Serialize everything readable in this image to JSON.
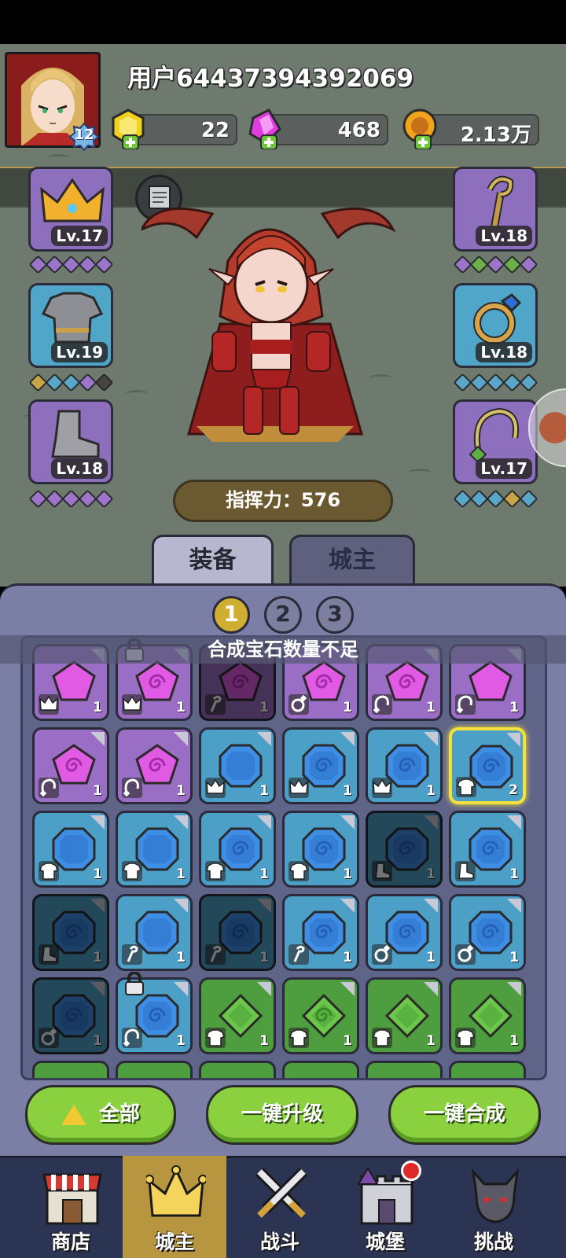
{
  "header": {
    "username": "用户64437394392069",
    "avatar_level": "12",
    "resources": [
      {
        "name": "gold-gem",
        "value": "22"
      },
      {
        "name": "pink-crystal",
        "value": "468"
      },
      {
        "name": "coin",
        "value": "2.13万"
      }
    ]
  },
  "equipment": {
    "left_slots": [
      {
        "item": "crown",
        "level": "Lv.17"
      },
      {
        "item": "armor",
        "level": "Lv.19"
      },
      {
        "item": "boots",
        "level": "Lv.18"
      }
    ],
    "right_slots": [
      {
        "item": "staff",
        "level": "Lv.18"
      },
      {
        "item": "ring",
        "level": "Lv.18"
      },
      {
        "item": "necklace",
        "level": "Lv.17"
      }
    ],
    "power_label": "指挥力：576"
  },
  "tabs": [
    {
      "label": "装备",
      "active": true
    },
    {
      "label": "城主",
      "active": false
    }
  ],
  "pages": [
    "1",
    "2",
    "3"
  ],
  "active_page": "1",
  "toast": "合成宝石数量不足",
  "inventory": [
    {
      "color": "purple",
      "type": "crown-icon",
      "count": "1",
      "dim": false,
      "locked": false,
      "spiral": false
    },
    {
      "color": "purple",
      "type": "crown-icon",
      "count": "1",
      "dim": false,
      "locked": true,
      "spiral": true
    },
    {
      "color": "purple",
      "type": "staff-icon",
      "count": "1",
      "dim": true,
      "locked": false,
      "spiral": true
    },
    {
      "color": "purple",
      "type": "ring-icon",
      "count": "1",
      "dim": false,
      "locked": false,
      "spiral": true
    },
    {
      "color": "purple",
      "type": "necklace-icon",
      "count": "1",
      "dim": false,
      "locked": false,
      "spiral": true
    },
    {
      "color": "purple",
      "type": "necklace-icon",
      "count": "1",
      "dim": false,
      "locked": false,
      "spiral": false
    },
    {
      "color": "purple",
      "type": "necklace-icon",
      "count": "1",
      "dim": false,
      "locked": false,
      "spiral": true
    },
    {
      "color": "purple",
      "type": "necklace-icon",
      "count": "1",
      "dim": false,
      "locked": false,
      "spiral": true
    },
    {
      "color": "blue",
      "type": "crown-icon",
      "count": "1",
      "dim": false,
      "locked": false,
      "spiral": false
    },
    {
      "color": "blue",
      "type": "crown-icon",
      "count": "1",
      "dim": false,
      "locked": false,
      "spiral": true
    },
    {
      "color": "blue",
      "type": "crown-icon",
      "count": "1",
      "dim": false,
      "locked": false,
      "spiral": true
    },
    {
      "color": "blue",
      "type": "armor-icon",
      "count": "2",
      "dim": false,
      "locked": false,
      "spiral": true,
      "selected": true
    },
    {
      "color": "blue",
      "type": "armor-icon",
      "count": "1",
      "dim": false,
      "locked": false,
      "spiral": false
    },
    {
      "color": "blue",
      "type": "armor-icon",
      "count": "1",
      "dim": false,
      "locked": false,
      "spiral": false
    },
    {
      "color": "blue",
      "type": "armor-icon",
      "count": "1",
      "dim": false,
      "locked": false,
      "spiral": true
    },
    {
      "color": "blue",
      "type": "armor-icon",
      "count": "1",
      "dim": false,
      "locked": false,
      "spiral": true
    },
    {
      "color": "blue",
      "type": "boots-icon",
      "count": "1",
      "dim": true,
      "locked": false,
      "spiral": true
    },
    {
      "color": "blue",
      "type": "boots-icon",
      "count": "1",
      "dim": false,
      "locked": false,
      "spiral": true
    },
    {
      "color": "blue",
      "type": "boots-icon",
      "count": "1",
      "dim": true,
      "locked": false,
      "spiral": true
    },
    {
      "color": "blue",
      "type": "staff-icon",
      "count": "1",
      "dim": false,
      "locked": false,
      "spiral": false
    },
    {
      "color": "blue",
      "type": "staff-icon",
      "count": "1",
      "dim": true,
      "locked": false,
      "spiral": true
    },
    {
      "color": "blue",
      "type": "staff-icon",
      "count": "1",
      "dim": false,
      "locked": false,
      "spiral": true
    },
    {
      "color": "blue",
      "type": "ring-icon",
      "count": "1",
      "dim": false,
      "locked": false,
      "spiral": true
    },
    {
      "color": "blue",
      "type": "ring-icon",
      "count": "1",
      "dim": false,
      "locked": false,
      "spiral": true
    },
    {
      "color": "blue",
      "type": "ring-icon",
      "count": "1",
      "dim": true,
      "locked": false,
      "spiral": true
    },
    {
      "color": "blue",
      "type": "necklace-icon",
      "count": "1",
      "dim": false,
      "locked": true,
      "spiral": true
    },
    {
      "color": "green",
      "type": "armor-icon",
      "count": "1",
      "dim": false,
      "locked": false,
      "spiral": false
    },
    {
      "color": "green",
      "type": "armor-icon",
      "count": "1",
      "dim": false,
      "locked": false,
      "spiral": true
    },
    {
      "color": "green",
      "type": "armor-icon",
      "count": "1",
      "dim": false,
      "locked": false,
      "spiral": false
    },
    {
      "color": "green",
      "type": "armor-icon",
      "count": "1",
      "dim": false,
      "locked": false,
      "spiral": false
    }
  ],
  "buttons": {
    "all": "全部",
    "upgrade_all": "一键升级",
    "merge_all": "一键合成"
  },
  "nav": [
    {
      "label": "商店",
      "icon": "shop-icon",
      "active": false
    },
    {
      "label": "城主",
      "icon": "crown-icon",
      "active": true
    },
    {
      "label": "战斗",
      "icon": "swords-icon",
      "active": false
    },
    {
      "label": "城堡",
      "icon": "castle-icon",
      "active": false
    },
    {
      "label": "挑战",
      "icon": "demon-icon",
      "active": false
    }
  ]
}
